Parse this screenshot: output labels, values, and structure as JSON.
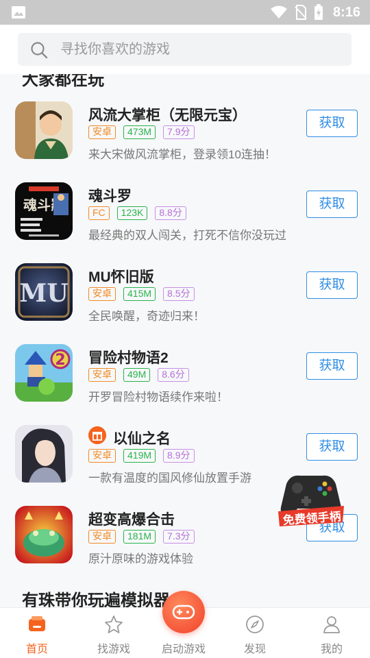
{
  "status_bar": {
    "time": "8:16"
  },
  "search": {
    "placeholder": "寻找你喜欢的游戏"
  },
  "sections": [
    {
      "title": "大家都在玩"
    },
    {
      "title": "有珠带你玩遍模拟器"
    }
  ],
  "games": [
    {
      "name": "风流大掌柜（无限元宝）",
      "platform": "安卓",
      "size": "473M",
      "score": "7.9分",
      "desc": "来大宋做风流掌柜，登录领10连抽！",
      "action": "获取",
      "icon": "feng-liu-da-zhang-gui-icon"
    },
    {
      "name": "魂斗罗",
      "platform": "FC",
      "size": "123K",
      "score": "8.8分",
      "desc": "最经典的双人闯关，打死不信你没玩过",
      "action": "获取",
      "icon": "contra-icon"
    },
    {
      "name": "MU怀旧版",
      "platform": "安卓",
      "size": "415M",
      "score": "8.5分",
      "desc": "全民唤醒，奇迹归来！",
      "action": "获取",
      "icon": "mu-icon"
    },
    {
      "name": "冒险村物语2",
      "platform": "安卓",
      "size": "49M",
      "score": "8.6分",
      "desc": "开罗冒险村物语续作来啦！",
      "action": "获取",
      "icon": "dungeon-village-2-icon"
    },
    {
      "name": "以仙之名",
      "platform": "安卓",
      "size": "419M",
      "score": "8.9分",
      "desc": "一款有温度的国风修仙放置手游",
      "action": "获取",
      "icon": "yi-xian-zhi-ming-icon",
      "gift": true
    },
    {
      "name": "超变高爆合击",
      "platform": "安卓",
      "size": "181M",
      "score": "7.3分",
      "desc": "原汁原味的游戏体验",
      "action": "获取",
      "icon": "chao-bian-gao-bao-icon"
    }
  ],
  "promo": {
    "label": "免费领手柄"
  },
  "nav": [
    {
      "label": "首页",
      "icon": "home-icon",
      "active": true
    },
    {
      "label": "找游戏",
      "icon": "star-icon"
    },
    {
      "label": "启动游戏",
      "icon": "gamepad-icon"
    },
    {
      "label": "发现",
      "icon": "compass-icon"
    },
    {
      "label": "我的",
      "icon": "person-icon"
    }
  ],
  "colors": {
    "accent": "#f5631f",
    "button_blue": "#2f8de4",
    "tag_orange": "#f08a24",
    "tag_green": "#27b34a",
    "tag_purple": "#b46fd8"
  }
}
